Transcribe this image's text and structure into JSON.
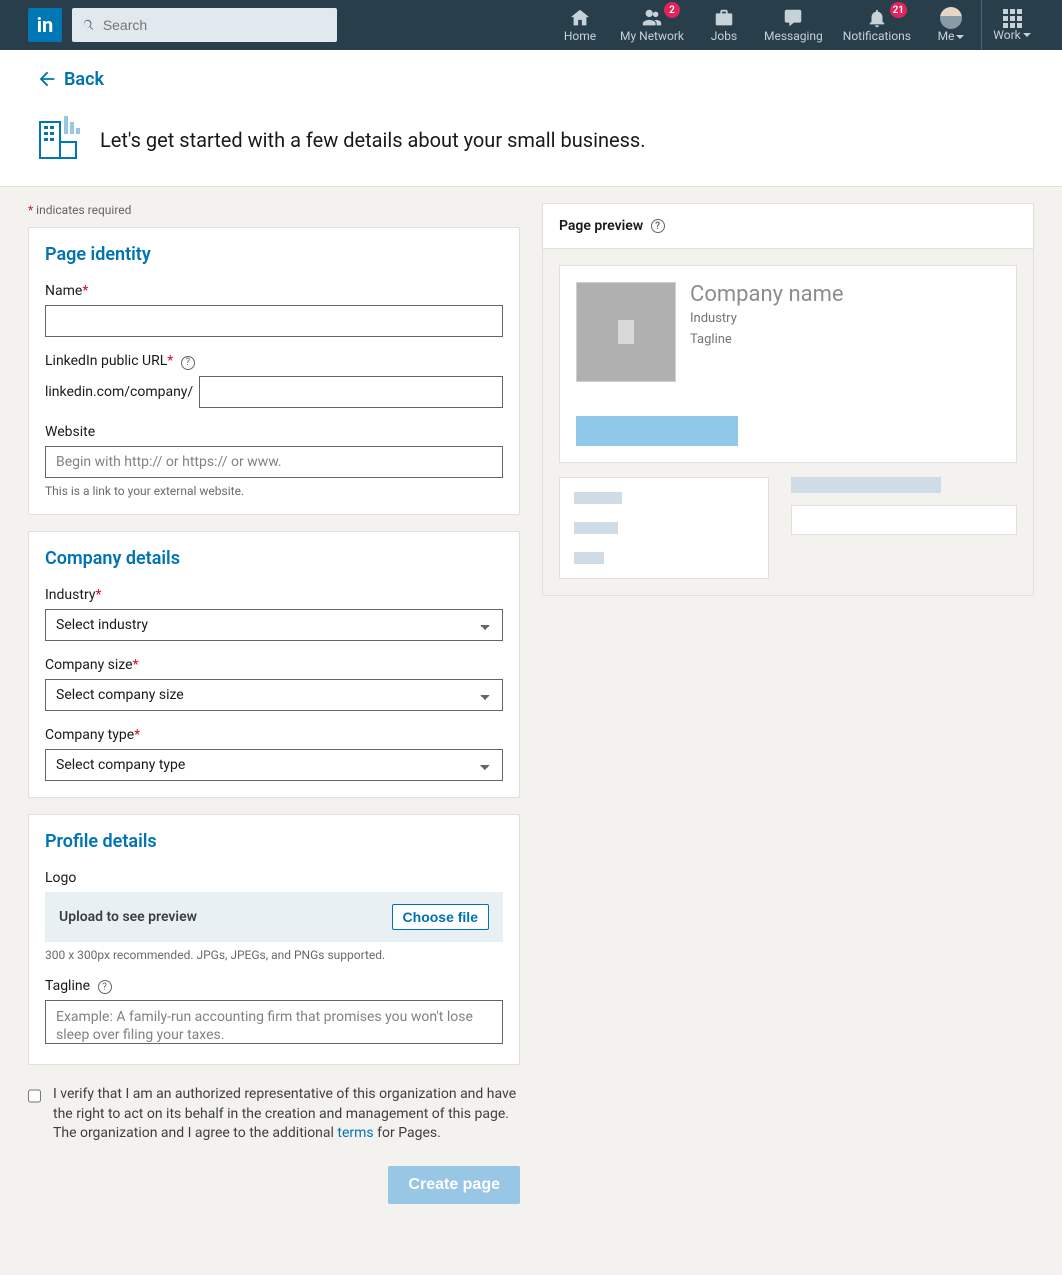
{
  "nav": {
    "search_placeholder": "Search",
    "items": {
      "home": "Home",
      "network": "My Network",
      "jobs": "Jobs",
      "messaging": "Messaging",
      "notifications": "Notifications",
      "me": "Me",
      "work": "Work"
    },
    "badges": {
      "network": "2",
      "notifications": "21"
    }
  },
  "back_label": "Back",
  "page_title": "Let's get started with a few details about your small business.",
  "required_note": "indicates required",
  "sections": {
    "identity": {
      "title": "Page identity",
      "name_label": "Name",
      "url_label": "LinkedIn public URL",
      "url_prefix": "linkedin.com/company/",
      "website_label": "Website",
      "website_placeholder": "Begin with http:// or https:// or www.",
      "website_hint": "This is a link to your external website."
    },
    "company": {
      "title": "Company details",
      "industry_label": "Industry",
      "industry_placeholder": "Select industry",
      "size_label": "Company size",
      "size_placeholder": "Select company size",
      "type_label": "Company type",
      "type_placeholder": "Select company type"
    },
    "profile": {
      "title": "Profile details",
      "logo_label": "Logo",
      "upload_text": "Upload to see preview",
      "choose_file": "Choose file",
      "logo_hint": "300 x 300px recommended. JPGs, JPEGs, and PNGs supported.",
      "tagline_label": "Tagline",
      "tagline_placeholder": "Example: A family-run accounting firm that promises you won't lose sleep over filing your taxes."
    }
  },
  "verify": {
    "pre": "I verify that I am an authorized representative of this organization and have the right to act on its behalf in the creation and management of this page. The organization and I agree to the additional ",
    "terms": "terms",
    "post": " for Pages."
  },
  "create_button": "Create page",
  "preview": {
    "header": "Page preview",
    "company_name": "Company name",
    "industry": "Industry",
    "tagline": "Tagline"
  }
}
